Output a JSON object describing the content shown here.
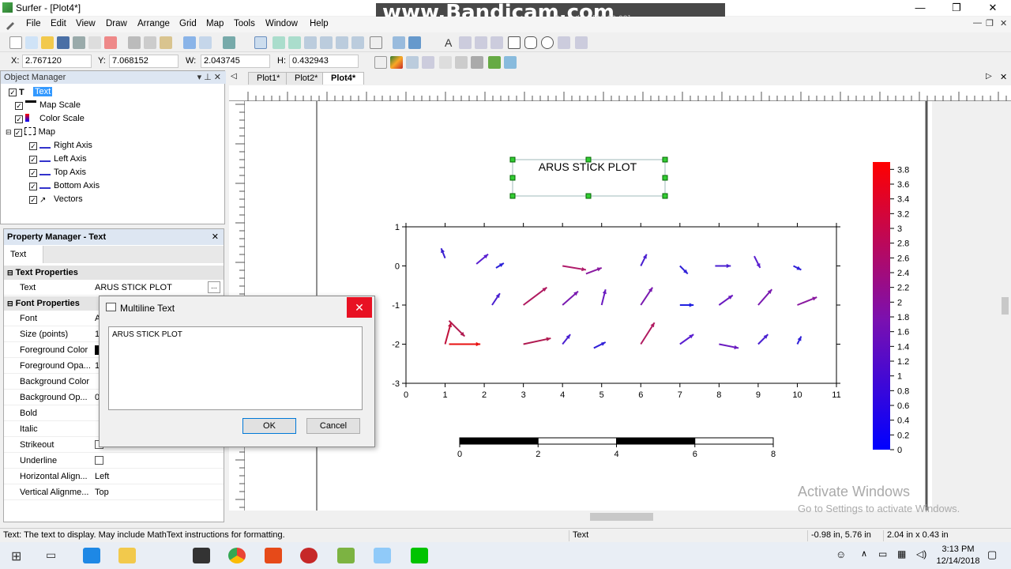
{
  "window": {
    "title": "Surfer - [Plot4*]",
    "min": "—",
    "max": "❐",
    "close": "✕"
  },
  "watermark": {
    "text": "www.Bandicam.com",
    "rec": "Recording [00:00:08]"
  },
  "menu": [
    "File",
    "Edit",
    "View",
    "Draw",
    "Arrange",
    "Grid",
    "Map",
    "Tools",
    "Window",
    "Help"
  ],
  "coords": {
    "x_label": "X:",
    "x": "2.767120",
    "y_label": "Y:",
    "y": "7.068152",
    "w_label": "W:",
    "w": "2.043745",
    "h_label": "H:",
    "h": "0.432943"
  },
  "object_manager": {
    "title": "Object Manager",
    "items": [
      {
        "label": "Text",
        "selected": true,
        "icon": "text-icon"
      },
      {
        "label": "Map Scale",
        "icon": "map-scale-icon"
      },
      {
        "label": "Color Scale",
        "icon": "color-scale-icon"
      },
      {
        "label": "Map",
        "icon": "map-icon"
      },
      {
        "label": "Right Axis",
        "icon": "axis-icon"
      },
      {
        "label": "Left Axis",
        "icon": "axis-icon"
      },
      {
        "label": "Top Axis",
        "icon": "axis-icon"
      },
      {
        "label": "Bottom Axis",
        "icon": "axis-icon"
      },
      {
        "label": "Vectors",
        "icon": "vectors-icon"
      }
    ]
  },
  "property_manager": {
    "title": "Property Manager - Text",
    "tab": "Text",
    "text_section": "Text Properties",
    "text_key": "Text",
    "text_value": "ARUS STICK PLOT",
    "font_section": "Font Properties",
    "rows": [
      {
        "k": "Font",
        "v": "A"
      },
      {
        "k": "Size (points)",
        "v": "1"
      },
      {
        "k": "Foreground Color",
        "v": ""
      },
      {
        "k": "Foreground Opa...",
        "v": "1"
      },
      {
        "k": "Background Color",
        "v": ""
      },
      {
        "k": "Background Op...",
        "v": "0"
      },
      {
        "k": "Bold",
        "v": ""
      },
      {
        "k": "Italic",
        "v": ""
      },
      {
        "k": "Strikeout",
        "v": ""
      },
      {
        "k": "Underline",
        "v": ""
      },
      {
        "k": "Horizontal Align...",
        "v": "Left"
      },
      {
        "k": "Vertical Alignme...",
        "v": "Top"
      }
    ]
  },
  "doc_tabs": [
    "Plot1*",
    "Plot2*",
    "Plot4*"
  ],
  "plot": {
    "title": "ARUS STICK PLOT",
    "x_ticks": [
      "0",
      "1",
      "2",
      "3",
      "4",
      "5",
      "6",
      "7",
      "8",
      "9",
      "10",
      "11"
    ],
    "y_ticks": [
      "1",
      "0",
      "-1",
      "-2",
      "-3"
    ],
    "scale_ticks": [
      "0",
      "2",
      "4",
      "6",
      "8"
    ],
    "colorbar_ticks": [
      "3.8",
      "3.6",
      "3.4",
      "3.2",
      "3",
      "2.8",
      "2.6",
      "2.4",
      "2.2",
      "2",
      "1.8",
      "1.6",
      "1.4",
      "1.2",
      "1",
      "0.8",
      "0.6",
      "0.4",
      "0.2",
      "0"
    ]
  },
  "dialog": {
    "title": "Multiline Text",
    "text": "ARUS STICK PLOT",
    "ok": "OK",
    "cancel": "Cancel"
  },
  "status": {
    "hint": "Text: The text to display.  May include MathText instructions for formatting.",
    "obj": "Text",
    "pos": "-0.98 in, 5.76 in",
    "size": "2.04 in x 0.43 in"
  },
  "activate": {
    "line1": "Activate Windows",
    "line2": "Go to Settings to activate Windows."
  },
  "clock": {
    "time": "3:13 PM",
    "date": "12/14/2018"
  }
}
